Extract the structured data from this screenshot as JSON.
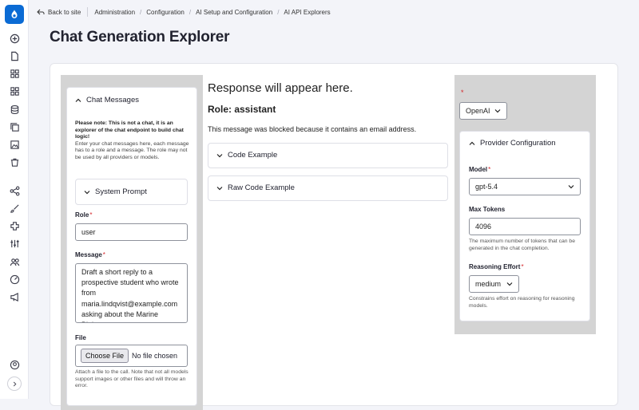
{
  "breadcrumb": {
    "back_label": "Back to site",
    "items": [
      "Administration",
      "Configuration",
      "AI Setup and Configuration",
      "AI API Explorers"
    ],
    "divider": "/"
  },
  "page": {
    "title": "Chat Generation Explorer"
  },
  "chat_messages": {
    "header": "Chat Messages",
    "note_bold": "Please note: This is not a chat, it is an explorer of the chat endpoint to build chat logic!",
    "note_text": "Enter your chat messages here, each message has to a role and a message. The role may not be used by all providers or models.",
    "system_prompt": "System Prompt",
    "role_label": "Role",
    "role_value": "user",
    "message_label": "Message",
    "message_value": "Draft a short reply to a prospective student who wrote from maria.lindqvist@example.com asking about the Marine Biology program.",
    "file_label": "File",
    "file_button": "Choose File",
    "file_status": "No file chosen",
    "file_help": "Attach a file to the call. Note that not all models support images or other files and will throw an error.",
    "required_mark": "*"
  },
  "response": {
    "placeholder": "Response will appear here.",
    "role_heading": "Role: assistant",
    "message": "This message was blocked because it contains an email address.",
    "code_example": "Code Example",
    "raw_code_example": "Raw Code Example"
  },
  "provider": {
    "required_mark": "*",
    "selected": "OpenAI",
    "config_header": "Provider Configuration",
    "model_label": "Model",
    "model_value": "gpt-5.4",
    "max_tokens_label": "Max Tokens",
    "max_tokens_value": "4096",
    "max_tokens_help": "The maximum number of tokens that can be generated in the chat completion.",
    "reasoning_label": "Reasoning Effort",
    "reasoning_value": "medium",
    "reasoning_help": "Constrains effort on reasoning for reasoning models."
  },
  "icons": {
    "sidebar": [
      "plus-circle-icon",
      "file-icon",
      "grid-icon",
      "grid-alt-icon",
      "database-icon",
      "copy-icon",
      "image-icon",
      "trash-icon",
      "structure-icon",
      "brush-icon",
      "extend-icon",
      "sliders-icon",
      "people-icon",
      "dashboard-icon",
      "megaphone-icon",
      "user-icon",
      "expand-icon"
    ]
  },
  "colors": {
    "brand": "#0b6bd4",
    "required": "#d5262a",
    "panel_gray": "#d4d4d4"
  }
}
